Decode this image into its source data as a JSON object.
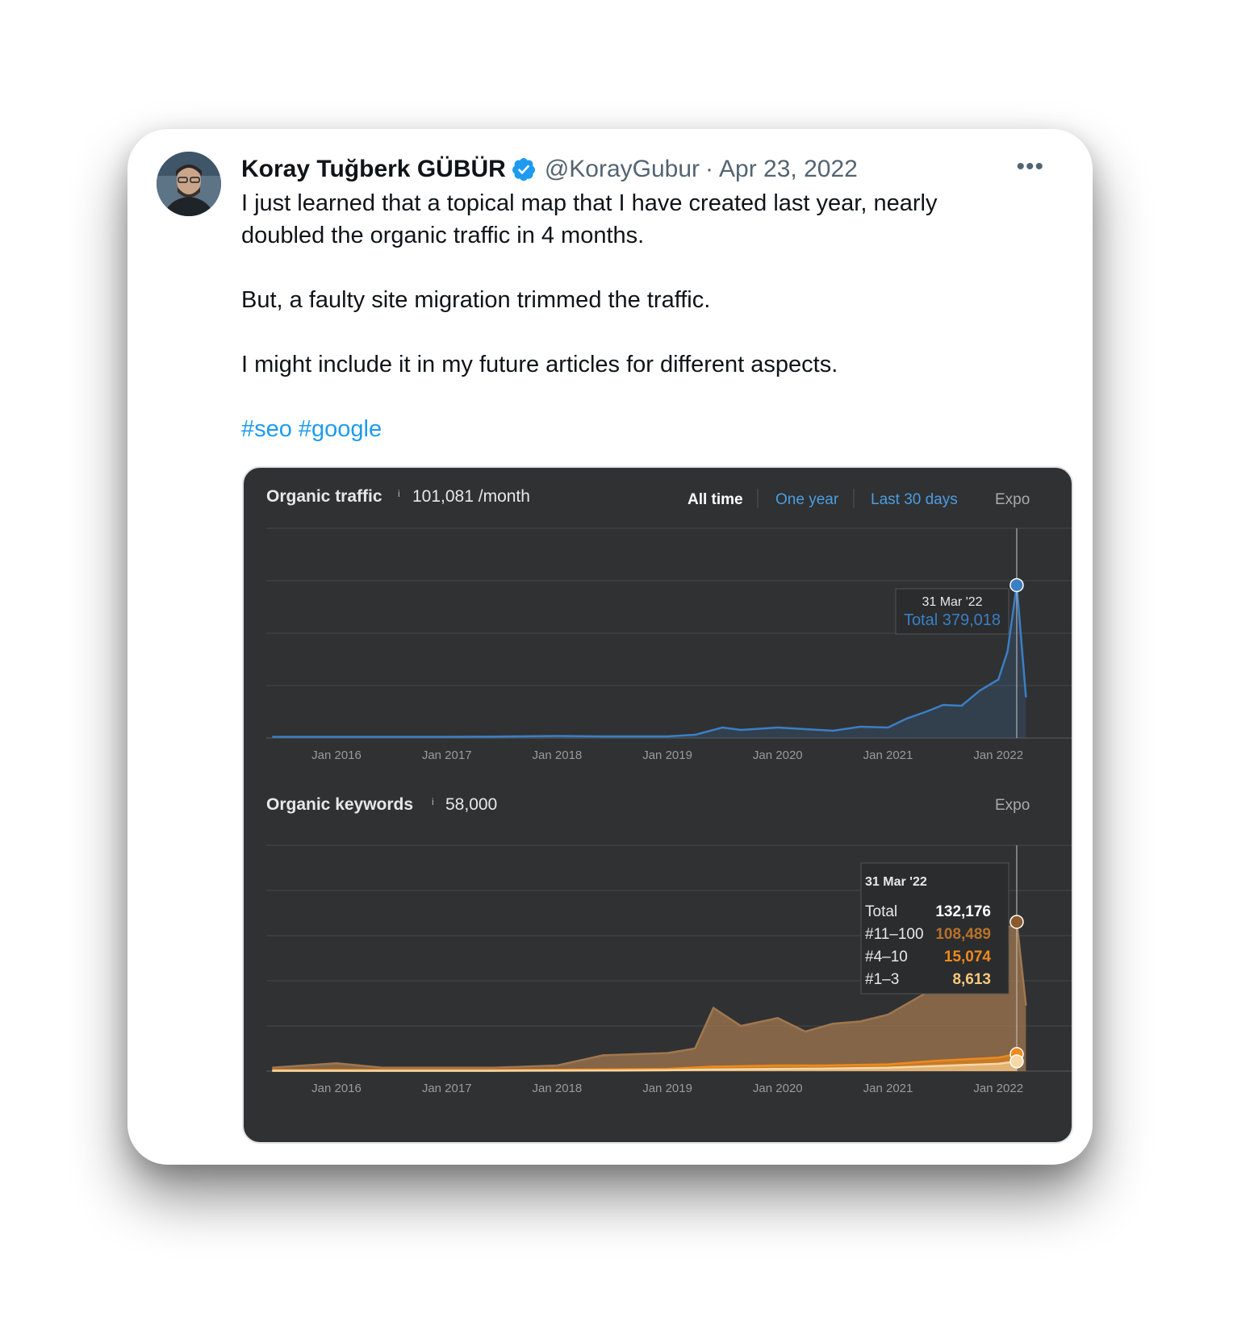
{
  "tweet": {
    "author_name": "Koray Tuğberk GÜBÜR",
    "handle": "@KorayGubur",
    "separator": "·",
    "date": "Apr 23, 2022",
    "more_label": "•••",
    "verified_icon": "verified-badge-icon",
    "paragraphs": [
      "I just learned that a topical map that I have created last year, nearly doubled the organic traffic in 4 months.",
      "But, a faulty site migration trimmed the traffic.",
      "I might include it in my future articles for different aspects."
    ],
    "hashtags": [
      "#seo",
      "#google"
    ],
    "colors": {
      "link": "#1d9bf0",
      "text": "#0f1419",
      "muted": "#536471",
      "verified": "#1d9bf0"
    }
  },
  "chart_panel": {
    "background": "#303133",
    "traffic_title": "Organic traffic",
    "info_mark": "i",
    "traffic_value": "101,081 /month",
    "range_tabs": [
      "All time",
      "One year",
      "Last 30 days"
    ],
    "active_tab": "All time",
    "export_label": "Expo",
    "keywords_title": "Organic keywords",
    "keywords_value": "58,000",
    "traffic_tooltip": {
      "date": "31 Mar '22",
      "label": "Total 379,018"
    },
    "keywords_tooltip": {
      "date": "31 Mar '22",
      "rows": [
        {
          "label": "Total",
          "value": "132,176",
          "color": "#ffffff"
        },
        {
          "label": "#11–100",
          "value": "108,489",
          "color": "#b8722a"
        },
        {
          "label": "#4–10",
          "value": "15,074",
          "color": "#f08a1a"
        },
        {
          "label": "#1–3",
          "value": "8,613",
          "color": "#f7c87a"
        }
      ]
    },
    "colors": {
      "traffic_line": "#3b7fc4",
      "keywords_total": "#a0774f",
      "keywords_4_10": "#f08a1a",
      "keywords_1_3": "#f7d7a4"
    }
  },
  "chart_data": [
    {
      "type": "area",
      "title": "Organic traffic",
      "x_ticks": [
        "Jan 2016",
        "Jan 2017",
        "Jan 2018",
        "Jan 2019",
        "Jan 2020",
        "Jan 2021",
        "Jan 2022"
      ],
      "ylim": [
        0,
        520000
      ],
      "grid": true,
      "series": [
        {
          "name": "Total",
          "x": [
            "2015-06",
            "2016-01",
            "2016-06",
            "2017-01",
            "2017-06",
            "2018-01",
            "2018-06",
            "2019-01",
            "2019-04",
            "2019-07",
            "2019-09",
            "2020-01",
            "2020-04",
            "2020-07",
            "2020-10",
            "2021-01",
            "2021-03",
            "2021-05",
            "2021-07",
            "2021-09",
            "2021-11",
            "2022-01",
            "2022-02",
            "2022-03",
            "2022-04"
          ],
          "values": [
            3000,
            3000,
            3000,
            3000,
            3500,
            5000,
            4000,
            4000,
            8000,
            26000,
            20000,
            26000,
            22000,
            18000,
            28000,
            26000,
            48000,
            64000,
            82000,
            80000,
            118000,
            145000,
            215000,
            379018,
            101081
          ]
        }
      ]
    },
    {
      "type": "area",
      "title": "Organic keywords",
      "x_ticks": [
        "Jan 2016",
        "Jan 2017",
        "Jan 2018",
        "Jan 2019",
        "Jan 2020",
        "Jan 2021",
        "Jan 2022"
      ],
      "ylim": [
        0,
        200000
      ],
      "grid": true,
      "series": [
        {
          "name": "Total",
          "x": [
            "2015-06",
            "2016-01",
            "2016-06",
            "2017-01",
            "2017-06",
            "2018-01",
            "2018-06",
            "2019-01",
            "2019-04",
            "2019-06",
            "2019-09",
            "2020-01",
            "2020-04",
            "2020-07",
            "2020-10",
            "2021-01",
            "2021-04",
            "2021-07",
            "2021-10",
            "2022-01",
            "2022-03",
            "2022-04"
          ],
          "values": [
            3000,
            7000,
            3000,
            3000,
            3000,
            5000,
            14000,
            16000,
            20000,
            56000,
            40000,
            47000,
            35000,
            42000,
            44000,
            50000,
            64000,
            78000,
            98000,
            121000,
            132176,
            58000
          ]
        },
        {
          "name": "#4–10",
          "x": [
            "2015-06",
            "2016-06",
            "2017-06",
            "2018-06",
            "2019-01",
            "2019-06",
            "2020-01",
            "2020-06",
            "2021-01",
            "2021-06",
            "2022-01",
            "2022-03"
          ],
          "values": [
            1000,
            1000,
            1000,
            1500,
            2000,
            4000,
            5000,
            5000,
            6000,
            9000,
            12000,
            15074
          ]
        },
        {
          "name": "#1–3",
          "x": [
            "2015-06",
            "2016-06",
            "2017-06",
            "2018-06",
            "2019-01",
            "2019-06",
            "2020-01",
            "2020-06",
            "2021-01",
            "2021-06",
            "2022-01",
            "2022-03"
          ],
          "values": [
            300,
            300,
            300,
            500,
            800,
            1500,
            2000,
            2200,
            3000,
            4500,
            6500,
            8613
          ]
        }
      ]
    }
  ]
}
